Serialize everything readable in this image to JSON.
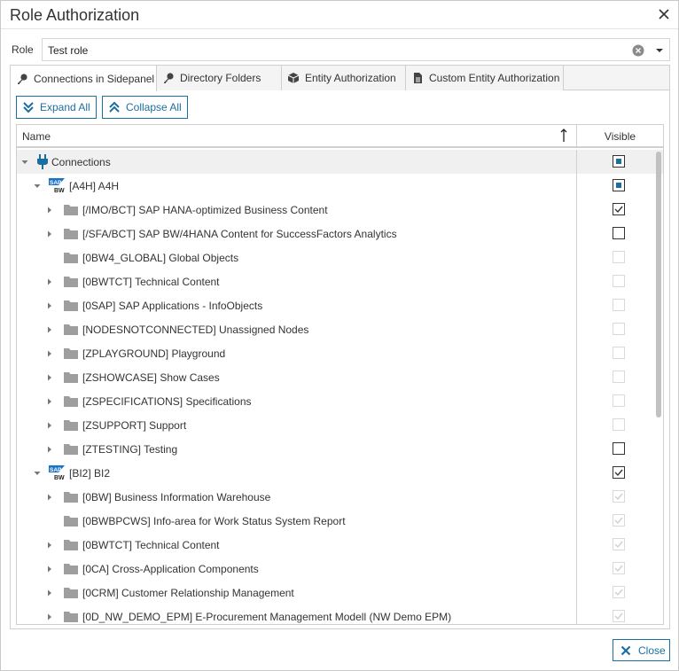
{
  "window": {
    "title": "Role Authorization",
    "close_icon": "close-icon"
  },
  "role": {
    "label": "Role",
    "value": "Test role"
  },
  "tabs": [
    {
      "label": "Connections in Sidepanel",
      "icon": "key-icon"
    },
    {
      "label": "Directory Folders",
      "icon": "key-icon"
    },
    {
      "label": "Entity Authorization",
      "icon": "cube-icon"
    },
    {
      "label": "Custom Entity Authorization",
      "icon": "document-icon"
    }
  ],
  "toolbar": {
    "expand_label": "Expand All",
    "collapse_label": "Collapse All"
  },
  "grid": {
    "col_name": "Name",
    "col_visible": "Visible"
  },
  "rows": [
    {
      "label": "Connections",
      "state": "partial",
      "enabled": true
    },
    {
      "label": "[A4H] A4H",
      "state": "partial",
      "enabled": true
    },
    {
      "label": "[/IMO/BCT] SAP HANA-optimized Business Content",
      "state": "checked",
      "enabled": true
    },
    {
      "label": "[/SFA/BCT] SAP BW/4HANA Content for SuccessFactors Analytics",
      "state": "unchecked",
      "enabled": true
    },
    {
      "label": "[0BW4_GLOBAL] Global Objects",
      "state": "unchecked",
      "enabled": false
    },
    {
      "label": "[0BWTCT] Technical Content",
      "state": "unchecked",
      "enabled": false
    },
    {
      "label": "[0SAP] SAP Applications - InfoObjects",
      "state": "unchecked",
      "enabled": false
    },
    {
      "label": "[NODESNOTCONNECTED] Unassigned Nodes",
      "state": "unchecked",
      "enabled": false
    },
    {
      "label": "[ZPLAYGROUND] Playground",
      "state": "unchecked",
      "enabled": false
    },
    {
      "label": "[ZSHOWCASE] Show Cases",
      "state": "unchecked",
      "enabled": false
    },
    {
      "label": "[ZSPECIFICATIONS] Specifications",
      "state": "unchecked",
      "enabled": false
    },
    {
      "label": "[ZSUPPORT] Support",
      "state": "unchecked",
      "enabled": false
    },
    {
      "label": "[ZTESTING] Testing",
      "state": "unchecked",
      "enabled": true
    },
    {
      "label": "[BI2] BI2",
      "state": "checked",
      "enabled": true
    },
    {
      "label": "[0BW] Business Information Warehouse",
      "state": "checked",
      "enabled": false
    },
    {
      "label": "[0BWBPCWS] Info-area for Work Status System Report",
      "state": "checked",
      "enabled": false
    },
    {
      "label": "[0BWTCT] Technical Content",
      "state": "checked",
      "enabled": false
    },
    {
      "label": "[0CA] Cross-Application Components",
      "state": "checked",
      "enabled": false
    },
    {
      "label": "[0CRM] Customer Relationship Management",
      "state": "checked",
      "enabled": false
    },
    {
      "label": "[0D_NW_DEMO_EPM] E-Procurement Management Modell (NW Demo EPM)",
      "state": "checked",
      "enabled": false
    }
  ],
  "icons": {
    "sap_logo_line1": "SAP",
    "sap_logo_line2": "BW"
  },
  "footer": {
    "close_label": "Close"
  },
  "colors": {
    "accent": "#1a6fa0",
    "folder": "#9e9e9e",
    "plug": "#1a6fa0"
  }
}
